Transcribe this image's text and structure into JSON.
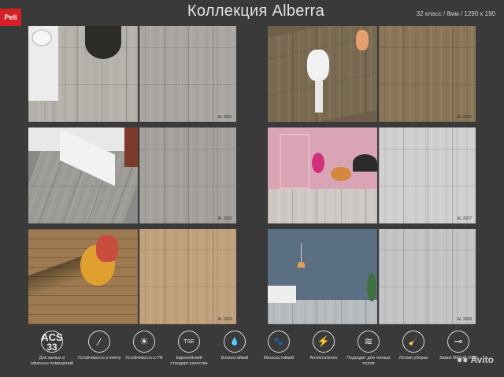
{
  "brand": "Peli",
  "title": "Коллекция Alberra",
  "spec": "32 класс / 8мм / 1290 x 190",
  "samples": [
    {
      "code": "AL 2001",
      "color": "#a9a6a1"
    },
    {
      "code": "AL 2002",
      "color": "#a4a19d"
    },
    {
      "code": "AL 2004",
      "color": "#c0a17c"
    },
    {
      "code": "AL 2006",
      "color": "#8a7556"
    },
    {
      "code": "AL 2007",
      "color": "#d2d0cf"
    },
    {
      "code": "AL 2008",
      "color": "#c3c4c6"
    }
  ],
  "features": [
    {
      "icon": "acs-33-icon",
      "acs": "ACS",
      "acs_num": "33",
      "label": "Для жилых и офисных помещений"
    },
    {
      "icon": "cigarette-icon",
      "glyph": "⁄",
      "label": "Устойчивость к пеплу"
    },
    {
      "icon": "sun-icon",
      "glyph": "☀",
      "label": "Устойчивость к УФ"
    },
    {
      "icon": "tse-icon",
      "glyph": "TSE",
      "label": "Европейский стандарт качества"
    },
    {
      "icon": "water-drop-icon",
      "glyph": "💧",
      "label": "Влагостойкий"
    },
    {
      "icon": "paw-icon",
      "glyph": "🐾",
      "label": "Износостойкий"
    },
    {
      "icon": "lightning-icon",
      "glyph": "⚡",
      "label": "Антистатичен"
    },
    {
      "icon": "heated-floor-icon",
      "glyph": "≋",
      "label": "Подходит для теплых полов"
    },
    {
      "icon": "cleaning-icon",
      "glyph": "🧹",
      "label": "Легкая уборка"
    },
    {
      "icon": "lock-icon",
      "glyph": "⊸",
      "label": "Замок MEGALOCK"
    }
  ],
  "watermark": "Avito"
}
